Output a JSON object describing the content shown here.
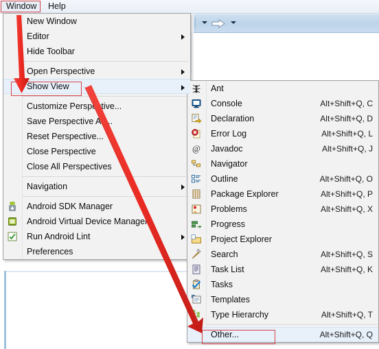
{
  "app": {
    "accent_red": "#ee2b23",
    "highlight_stroke": "#d4434a",
    "menu_bg": "#f2f2f2",
    "toolbar_bg": "#c3d8ec"
  },
  "menubar": {
    "items": [
      {
        "label": "Window",
        "name": "menubar-item-window",
        "selected": true
      },
      {
        "label": "Help",
        "name": "menubar-item-help",
        "selected": false
      }
    ]
  },
  "toolbar": {
    "icons": [
      "dropdown-caret-icon",
      "forward-arrow-icon",
      "dropdown-caret-icon"
    ]
  },
  "window_menu": {
    "name": "window-menu",
    "items": [
      {
        "label": "New Window",
        "icon": "",
        "submenu": false,
        "separator_after": false
      },
      {
        "label": "Editor",
        "icon": "",
        "submenu": true,
        "separator_after": false
      },
      {
        "label": "Hide Toolbar",
        "icon": "",
        "submenu": false,
        "separator_after": true
      },
      {
        "label": "Open Perspective",
        "icon": "",
        "submenu": true,
        "separator_after": false
      },
      {
        "label": "Show View",
        "icon": "",
        "submenu": true,
        "separator_after": true,
        "highlighted": true
      },
      {
        "label": "Customize Perspective...",
        "icon": "",
        "submenu": false,
        "separator_after": false
      },
      {
        "label": "Save Perspective As...",
        "icon": "",
        "submenu": false,
        "separator_after": false
      },
      {
        "label": "Reset Perspective...",
        "icon": "",
        "submenu": false,
        "separator_after": false
      },
      {
        "label": "Close Perspective",
        "icon": "",
        "submenu": false,
        "separator_after": false
      },
      {
        "label": "Close All Perspectives",
        "icon": "",
        "submenu": false,
        "separator_after": true
      },
      {
        "label": "Navigation",
        "icon": "",
        "submenu": true,
        "separator_after": true
      },
      {
        "label": "Android SDK Manager",
        "icon": "android-sdk-manager-icon",
        "submenu": false,
        "separator_after": false
      },
      {
        "label": "Android Virtual Device Manager",
        "icon": "android-avd-manager-icon",
        "submenu": false,
        "separator_after": false
      },
      {
        "label": "Run Android Lint",
        "icon": "android-lint-icon",
        "submenu": true,
        "separator_after": false
      },
      {
        "label": "Preferences",
        "icon": "",
        "submenu": false,
        "separator_after": false
      }
    ]
  },
  "show_view_submenu": {
    "name": "show-view-submenu",
    "items": [
      {
        "label": "Ant",
        "accel": "",
        "icon": "ant-icon",
        "separator_after": false
      },
      {
        "label": "Console",
        "accel": "Alt+Shift+Q, C",
        "icon": "console-icon",
        "separator_after": false
      },
      {
        "label": "Declaration",
        "accel": "Alt+Shift+Q, D",
        "icon": "declaration-icon",
        "separator_after": false
      },
      {
        "label": "Error Log",
        "accel": "Alt+Shift+Q, L",
        "icon": "error-log-icon",
        "separator_after": false
      },
      {
        "label": "Javadoc",
        "accel": "Alt+Shift+Q, J",
        "icon": "javadoc-icon",
        "separator_after": false
      },
      {
        "label": "Navigator",
        "accel": "",
        "icon": "navigator-icon",
        "separator_after": false
      },
      {
        "label": "Outline",
        "accel": "Alt+Shift+Q, O",
        "icon": "outline-icon",
        "separator_after": false
      },
      {
        "label": "Package Explorer",
        "accel": "Alt+Shift+Q, P",
        "icon": "package-explorer-icon",
        "separator_after": false
      },
      {
        "label": "Problems",
        "accel": "Alt+Shift+Q, X",
        "icon": "problems-icon",
        "separator_after": false
      },
      {
        "label": "Progress",
        "accel": "",
        "icon": "progress-icon",
        "separator_after": false
      },
      {
        "label": "Project Explorer",
        "accel": "",
        "icon": "project-explorer-icon",
        "separator_after": false
      },
      {
        "label": "Search",
        "accel": "Alt+Shift+Q, S",
        "icon": "search-icon",
        "separator_after": false
      },
      {
        "label": "Task List",
        "accel": "Alt+Shift+Q, K",
        "icon": "task-list-icon",
        "separator_after": false
      },
      {
        "label": "Tasks",
        "accel": "",
        "icon": "tasks-icon",
        "separator_after": false
      },
      {
        "label": "Templates",
        "accel": "",
        "icon": "templates-icon",
        "separator_after": false
      },
      {
        "label": "Type Hierarchy",
        "accel": "Alt+Shift+Q, T",
        "icon": "type-hierarchy-icon",
        "separator_after": true
      },
      {
        "label": "Other...",
        "accel": "Alt+Shift+Q, Q",
        "icon": "",
        "separator_after": false,
        "highlighted": true
      }
    ]
  },
  "annotations": {
    "arrows": [
      {
        "name": "arrow-window-to-show-view",
        "color": "#ee2b23"
      },
      {
        "name": "arrow-show-view-to-other",
        "color": "#ee2b23"
      }
    ],
    "boxes": [
      {
        "name": "highlight-window-menubar"
      },
      {
        "name": "highlight-show-view"
      },
      {
        "name": "highlight-other"
      }
    ]
  }
}
